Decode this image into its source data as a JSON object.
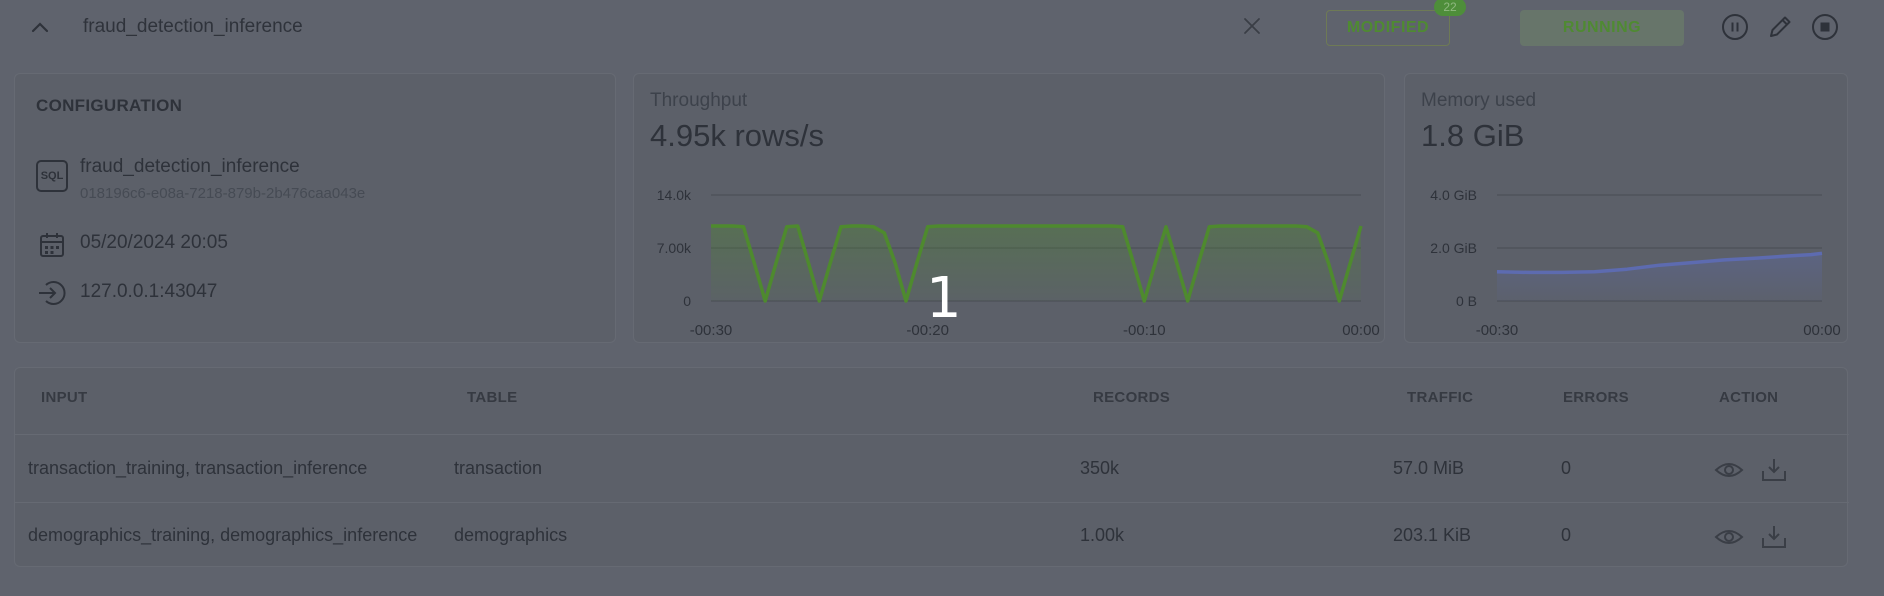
{
  "header": {
    "pipeline_name": "fraud_detection_inference",
    "modified_label": "MODIFIED",
    "modified_count": "22",
    "running_label": "RUNNING",
    "icons": [
      "chevron-up-icon",
      "close-icon",
      "pause-icon",
      "pencil-icon",
      "stop-icon"
    ]
  },
  "configuration": {
    "title": "CONFIGURATION",
    "sql_icon_label": "SQL",
    "name": "fraud_detection_inference",
    "id": "018196c6-e08a-7218-879b-2b476caa043e",
    "date": "05/20/2024 20:05",
    "address": "127.0.0.1:43047"
  },
  "throughput": {
    "label": "Throughput",
    "value": "4.95k rows/s",
    "chart_data": {
      "type": "area",
      "y_ticks": [
        "14.0k",
        "7.00k",
        "0"
      ],
      "x_ticks": [
        "-00:30",
        "-00:20",
        "-00:10",
        "00:00"
      ],
      "ylim": [
        0,
        14000
      ],
      "xlim": [
        -30,
        0
      ],
      "color": "#4e8a2e",
      "x": [
        -30,
        -29.5,
        -29,
        -28.5,
        -28,
        -27.5,
        -27,
        -26.5,
        -26,
        -25.5,
        -25,
        -24.5,
        -24,
        -23.5,
        -23,
        -22.5,
        -22,
        -21.5,
        -21,
        -20.5,
        -20,
        -19.5,
        -19,
        -18.5,
        -18,
        -17.5,
        -17,
        -16.5,
        -16,
        -15.5,
        -15,
        -14.5,
        -14,
        -13.5,
        -13,
        -12.5,
        -12,
        -11.5,
        -11,
        -10.5,
        -10,
        -9.5,
        -9,
        -8.5,
        -8,
        -7.5,
        -7,
        -6.5,
        -6,
        -5.5,
        -5,
        -4.5,
        -4,
        -3.5,
        -3,
        -2.5,
        -2,
        -1.5,
        -1,
        -0.5,
        0
      ],
      "y": [
        9900,
        9900,
        9900,
        9800,
        5000,
        0,
        5000,
        9800,
        9900,
        5000,
        0,
        5000,
        9800,
        9900,
        9900,
        9800,
        9000,
        5000,
        0,
        5000,
        9800,
        9900,
        9900,
        9900,
        9900,
        9900,
        9900,
        9900,
        9900,
        9900,
        9900,
        9900,
        9900,
        9900,
        9900,
        9900,
        9900,
        9900,
        9800,
        5000,
        0,
        5000,
        9800,
        5000,
        0,
        5000,
        9800,
        9900,
        9900,
        9900,
        9900,
        9900,
        9900,
        9900,
        9900,
        9800,
        9000,
        5000,
        0,
        5000,
        9900
      ]
    }
  },
  "memory": {
    "label": "Memory used",
    "value": "1.8 GiB",
    "chart_data": {
      "type": "area",
      "y_ticks": [
        "4.0 GiB",
        "2.0 GiB",
        "0 B"
      ],
      "x_ticks": [
        "-00:30",
        "00:00"
      ],
      "ylim": [
        0,
        4
      ],
      "xlim": [
        -30,
        0
      ],
      "color": "#5d6bb0",
      "x": [
        -30,
        -27,
        -24,
        -21,
        -18,
        -15,
        -12,
        -9,
        -6,
        -3,
        -1,
        0
      ],
      "y": [
        1.1,
        1.08,
        1.08,
        1.1,
        1.2,
        1.35,
        1.45,
        1.55,
        1.62,
        1.7,
        1.75,
        1.8
      ]
    }
  },
  "inputs_table": {
    "columns": [
      "INPUT",
      "TABLE",
      "RECORDS",
      "TRAFFIC",
      "ERRORS",
      "ACTION"
    ],
    "rows": [
      {
        "input": "transaction_training, transaction_inference",
        "table": "transaction",
        "records": "350k",
        "traffic": "57.0 MiB",
        "errors": "0"
      },
      {
        "input": "demographics_training, demographics_inference",
        "table": "demographics",
        "records": "1.00k",
        "traffic": "203.1 KiB",
        "errors": "0"
      }
    ],
    "action_icons": [
      "eye-icon",
      "download-icon"
    ]
  },
  "overlay": {
    "label": "1"
  }
}
